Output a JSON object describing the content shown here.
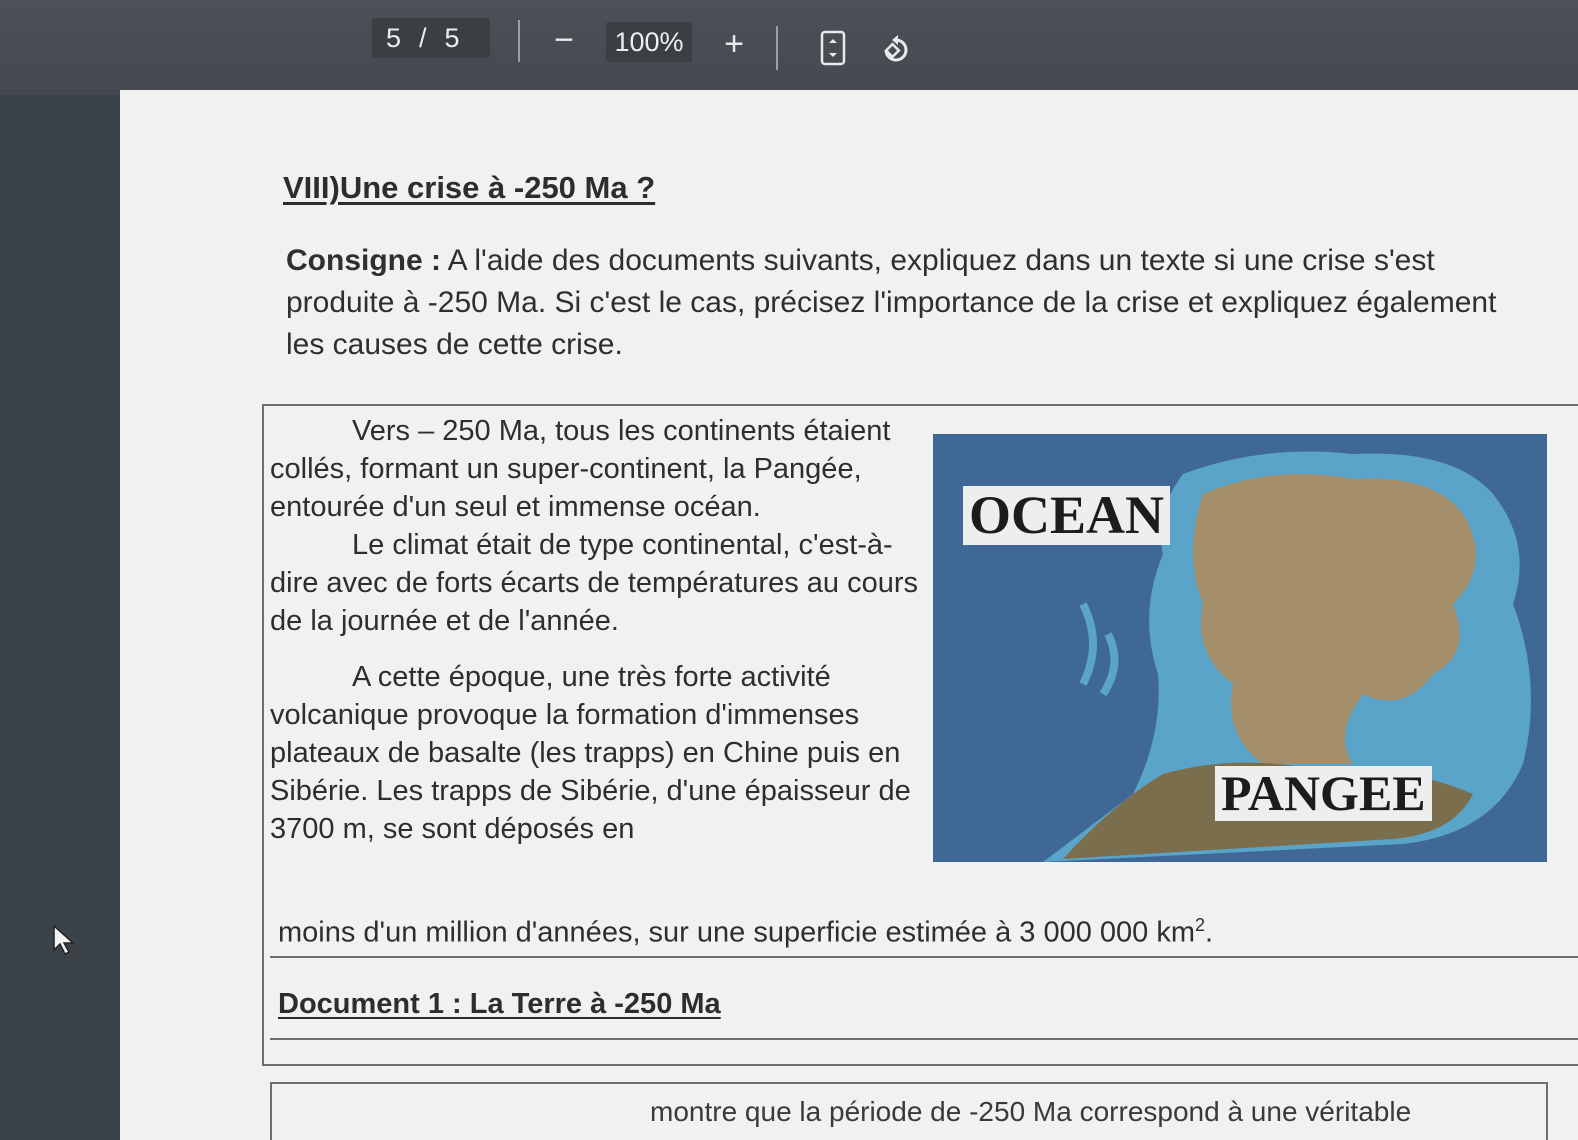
{
  "toolbar": {
    "current_page": "5",
    "page_separator": "/",
    "total_pages": "5",
    "zoom_out": "−",
    "zoom_level": "100%",
    "zoom_in": "+"
  },
  "document": {
    "heading": "VIII)Une crise à -250 Ma ?",
    "consigne_label": "Consigne :",
    "consigne_text": " A l'aide des documents suivants, expliquez dans un texte si une crise s'est produite à -250 Ma. Si c'est le cas, précisez l'importance de la crise et expliquez également les causes de cette crise.",
    "para1": "Vers – 250 Ma, tous les continents étaient collés, formant un super-continent, la Pangée, entourée d'un seul et immense océan.",
    "para2": "Le climat était de type continental, c'est-à-dire avec de forts écarts de températures au cours de la journée et de l'année.",
    "para3": "A cette époque, une très forte activité volcanique provoque la formation d'immenses plateaux de basalte (les trapps) en Chine puis en Sibérie. Les trapps de Sibérie, d'une épaisseur de 3700 m, se sont déposés en",
    "para3_tail": "moins d'un million d'années, sur une superficie estimée à 3 000 000 km",
    "para3_exp": "2",
    "para3_end": ".",
    "caption": "Document 1 : La Terre à -250 Ma",
    "next_doc_fragment": "montre que la période de -250 Ma correspond à une véritable",
    "map": {
      "ocean_label": "OCEAN",
      "pangee_label": "PANGEE",
      "colors": {
        "ocean": "#3f6896",
        "shelf": "#5aa3c9",
        "land": "#a58f6a",
        "land_dark": "#7a6e4c"
      }
    }
  }
}
